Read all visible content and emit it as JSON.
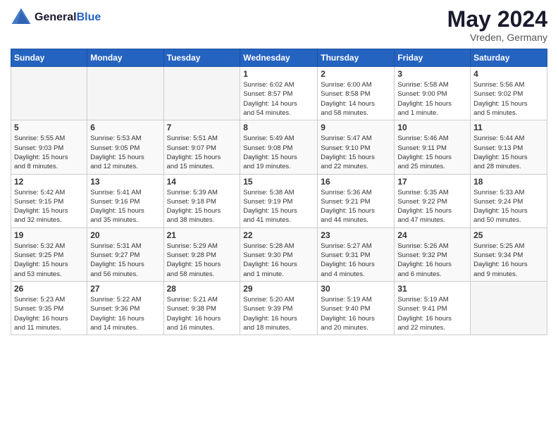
{
  "header": {
    "logo_line1": "General",
    "logo_line2": "Blue",
    "month_title": "May 2024",
    "subtitle": "Vreden, Germany"
  },
  "weekdays": [
    "Sunday",
    "Monday",
    "Tuesday",
    "Wednesday",
    "Thursday",
    "Friday",
    "Saturday"
  ],
  "weeks": [
    [
      {
        "day": "",
        "info": ""
      },
      {
        "day": "",
        "info": ""
      },
      {
        "day": "",
        "info": ""
      },
      {
        "day": "1",
        "info": "Sunrise: 6:02 AM\nSunset: 8:57 PM\nDaylight: 14 hours\nand 54 minutes."
      },
      {
        "day": "2",
        "info": "Sunrise: 6:00 AM\nSunset: 8:58 PM\nDaylight: 14 hours\nand 58 minutes."
      },
      {
        "day": "3",
        "info": "Sunrise: 5:58 AM\nSunset: 9:00 PM\nDaylight: 15 hours\nand 1 minute."
      },
      {
        "day": "4",
        "info": "Sunrise: 5:56 AM\nSunset: 9:02 PM\nDaylight: 15 hours\nand 5 minutes."
      }
    ],
    [
      {
        "day": "5",
        "info": "Sunrise: 5:55 AM\nSunset: 9:03 PM\nDaylight: 15 hours\nand 8 minutes."
      },
      {
        "day": "6",
        "info": "Sunrise: 5:53 AM\nSunset: 9:05 PM\nDaylight: 15 hours\nand 12 minutes."
      },
      {
        "day": "7",
        "info": "Sunrise: 5:51 AM\nSunset: 9:07 PM\nDaylight: 15 hours\nand 15 minutes."
      },
      {
        "day": "8",
        "info": "Sunrise: 5:49 AM\nSunset: 9:08 PM\nDaylight: 15 hours\nand 19 minutes."
      },
      {
        "day": "9",
        "info": "Sunrise: 5:47 AM\nSunset: 9:10 PM\nDaylight: 15 hours\nand 22 minutes."
      },
      {
        "day": "10",
        "info": "Sunrise: 5:46 AM\nSunset: 9:11 PM\nDaylight: 15 hours\nand 25 minutes."
      },
      {
        "day": "11",
        "info": "Sunrise: 5:44 AM\nSunset: 9:13 PM\nDaylight: 15 hours\nand 28 minutes."
      }
    ],
    [
      {
        "day": "12",
        "info": "Sunrise: 5:42 AM\nSunset: 9:15 PM\nDaylight: 15 hours\nand 32 minutes."
      },
      {
        "day": "13",
        "info": "Sunrise: 5:41 AM\nSunset: 9:16 PM\nDaylight: 15 hours\nand 35 minutes."
      },
      {
        "day": "14",
        "info": "Sunrise: 5:39 AM\nSunset: 9:18 PM\nDaylight: 15 hours\nand 38 minutes."
      },
      {
        "day": "15",
        "info": "Sunrise: 5:38 AM\nSunset: 9:19 PM\nDaylight: 15 hours\nand 41 minutes."
      },
      {
        "day": "16",
        "info": "Sunrise: 5:36 AM\nSunset: 9:21 PM\nDaylight: 15 hours\nand 44 minutes."
      },
      {
        "day": "17",
        "info": "Sunrise: 5:35 AM\nSunset: 9:22 PM\nDaylight: 15 hours\nand 47 minutes."
      },
      {
        "day": "18",
        "info": "Sunrise: 5:33 AM\nSunset: 9:24 PM\nDaylight: 15 hours\nand 50 minutes."
      }
    ],
    [
      {
        "day": "19",
        "info": "Sunrise: 5:32 AM\nSunset: 9:25 PM\nDaylight: 15 hours\nand 53 minutes."
      },
      {
        "day": "20",
        "info": "Sunrise: 5:31 AM\nSunset: 9:27 PM\nDaylight: 15 hours\nand 56 minutes."
      },
      {
        "day": "21",
        "info": "Sunrise: 5:29 AM\nSunset: 9:28 PM\nDaylight: 15 hours\nand 58 minutes."
      },
      {
        "day": "22",
        "info": "Sunrise: 5:28 AM\nSunset: 9:30 PM\nDaylight: 16 hours\nand 1 minute."
      },
      {
        "day": "23",
        "info": "Sunrise: 5:27 AM\nSunset: 9:31 PM\nDaylight: 16 hours\nand 4 minutes."
      },
      {
        "day": "24",
        "info": "Sunrise: 5:26 AM\nSunset: 9:32 PM\nDaylight: 16 hours\nand 6 minutes."
      },
      {
        "day": "25",
        "info": "Sunrise: 5:25 AM\nSunset: 9:34 PM\nDaylight: 16 hours\nand 9 minutes."
      }
    ],
    [
      {
        "day": "26",
        "info": "Sunrise: 5:23 AM\nSunset: 9:35 PM\nDaylight: 16 hours\nand 11 minutes."
      },
      {
        "day": "27",
        "info": "Sunrise: 5:22 AM\nSunset: 9:36 PM\nDaylight: 16 hours\nand 14 minutes."
      },
      {
        "day": "28",
        "info": "Sunrise: 5:21 AM\nSunset: 9:38 PM\nDaylight: 16 hours\nand 16 minutes."
      },
      {
        "day": "29",
        "info": "Sunrise: 5:20 AM\nSunset: 9:39 PM\nDaylight: 16 hours\nand 18 minutes."
      },
      {
        "day": "30",
        "info": "Sunrise: 5:19 AM\nSunset: 9:40 PM\nDaylight: 16 hours\nand 20 minutes."
      },
      {
        "day": "31",
        "info": "Sunrise: 5:19 AM\nSunset: 9:41 PM\nDaylight: 16 hours\nand 22 minutes."
      },
      {
        "day": "",
        "info": ""
      }
    ]
  ]
}
